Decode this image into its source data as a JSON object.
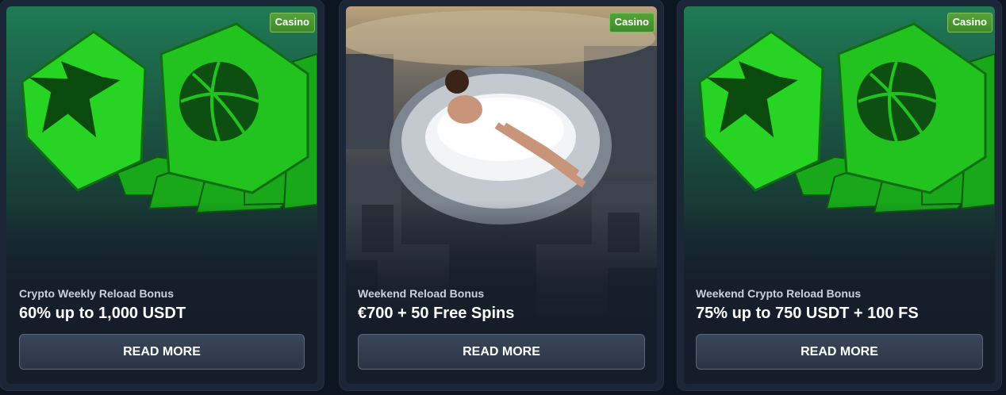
{
  "cards": [
    {
      "badge": "Casino",
      "subtitle": "Crypto Weekly Reload Bonus",
      "title": "60% up to 1,000 USDT",
      "button_label": "READ MORE"
    },
    {
      "badge": "Casino",
      "subtitle": "Weekend Reload Bonus",
      "title": "€700 + 50 Free Spins",
      "button_label": "READ MORE"
    },
    {
      "badge": "Casino",
      "subtitle": "Weekend Crypto Reload Bonus",
      "title": "75% up to 750 USDT + 100 FS",
      "button_label": "READ MORE"
    }
  ],
  "colors": {
    "badge_green": "#4a9733",
    "button_bg": "#323d4f",
    "page_bg": "#0d1520",
    "accent_green": "#22c31f"
  }
}
